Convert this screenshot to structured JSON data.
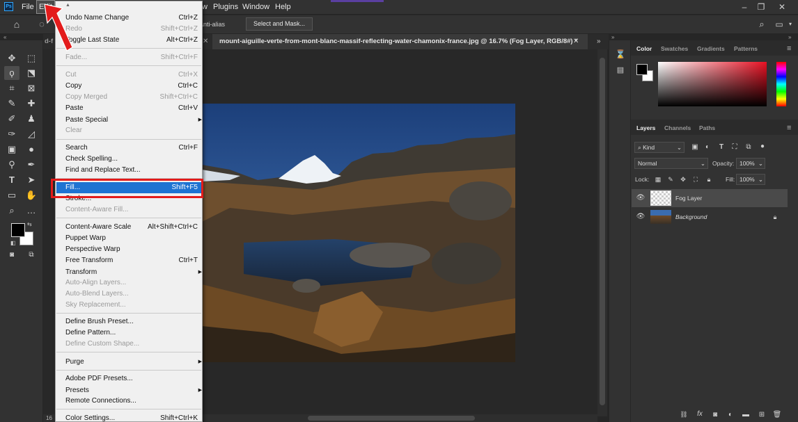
{
  "menubar": {
    "items": [
      "File",
      "Edit",
      "w",
      "Plugins",
      "Window",
      "Help"
    ]
  },
  "options_bar": {
    "anti_alias": "Anti-alias",
    "select_mask": "Select and Mask..."
  },
  "document": {
    "left_tab": "d-f",
    "tab_title": "mount-aiguille-verte-from-mont-blanc-massif-reflecting-water-chamonix-france.jpg @ 16.7% (Fog Layer, RGB/8#) *",
    "zoom_partial": "16"
  },
  "color_panel": {
    "tabs": [
      "Color",
      "Swatches",
      "Gradients",
      "Patterns"
    ]
  },
  "layers_panel": {
    "tabs": [
      "Layers",
      "Channels",
      "Paths"
    ],
    "filter": "Kind",
    "blend_mode": "Normal",
    "opacity_label": "Opacity:",
    "opacity_value": "100%",
    "lock_label": "Lock:",
    "fill_label": "Fill:",
    "fill_value": "100%",
    "layers": [
      {
        "name": "Fog Layer",
        "selected": true
      },
      {
        "name": "Background",
        "selected": false,
        "locked": true
      }
    ]
  },
  "edit_menu": {
    "items": [
      {
        "label": "Undo Name Change",
        "shortcut": "Ctrl+Z"
      },
      {
        "label": "Redo",
        "shortcut": "Shift+Ctrl+Z",
        "disabled": true
      },
      {
        "label": "Toggle Last State",
        "shortcut": "Alt+Ctrl+Z"
      },
      {
        "label": "Fade...",
        "shortcut": "Shift+Ctrl+F",
        "disabled": true
      },
      {
        "label": "Cut",
        "shortcut": "Ctrl+X",
        "disabled": true
      },
      {
        "label": "Copy",
        "shortcut": "Ctrl+C"
      },
      {
        "label": "Copy Merged",
        "shortcut": "Shift+Ctrl+C",
        "disabled": true
      },
      {
        "label": "Paste",
        "shortcut": "Ctrl+V"
      },
      {
        "label": "Paste Special",
        "shortcut": "",
        "submenu": true
      },
      {
        "label": "Clear",
        "shortcut": "",
        "disabled": true
      },
      {
        "label": "Search",
        "shortcut": "Ctrl+F"
      },
      {
        "label": "Check Spelling...",
        "shortcut": ""
      },
      {
        "label": "Find and Replace Text...",
        "shortcut": ""
      },
      {
        "label": "Fill...",
        "shortcut": "Shift+F5",
        "highlighted": true
      },
      {
        "label": "Stroke...",
        "shortcut": ""
      },
      {
        "label": "Content-Aware Fill...",
        "shortcut": "",
        "disabled": true
      },
      {
        "label": "Content-Aware Scale",
        "shortcut": "Alt+Shift+Ctrl+C"
      },
      {
        "label": "Puppet Warp",
        "shortcut": ""
      },
      {
        "label": "Perspective Warp",
        "shortcut": ""
      },
      {
        "label": "Free Transform",
        "shortcut": "Ctrl+T"
      },
      {
        "label": "Transform",
        "shortcut": "",
        "submenu": true
      },
      {
        "label": "Auto-Align Layers...",
        "shortcut": "",
        "disabled": true
      },
      {
        "label": "Auto-Blend Layers...",
        "shortcut": "",
        "disabled": true
      },
      {
        "label": "Sky Replacement...",
        "shortcut": "",
        "disabled": true
      },
      {
        "label": "Define Brush Preset...",
        "shortcut": ""
      },
      {
        "label": "Define Pattern...",
        "shortcut": ""
      },
      {
        "label": "Define Custom Shape...",
        "shortcut": "",
        "disabled": true
      },
      {
        "label": "Purge",
        "shortcut": "",
        "submenu": true
      },
      {
        "label": "Adobe PDF Presets...",
        "shortcut": ""
      },
      {
        "label": "Presets",
        "shortcut": "",
        "submenu": true
      },
      {
        "label": "Remote Connections...",
        "shortcut": ""
      },
      {
        "label": "Color Settings...",
        "shortcut": "Shift+Ctrl+K"
      }
    ]
  },
  "colors": {
    "menu_highlight": "#1e73d2",
    "annotation_red": "#e31b1b",
    "ui_dark": "#323232"
  }
}
